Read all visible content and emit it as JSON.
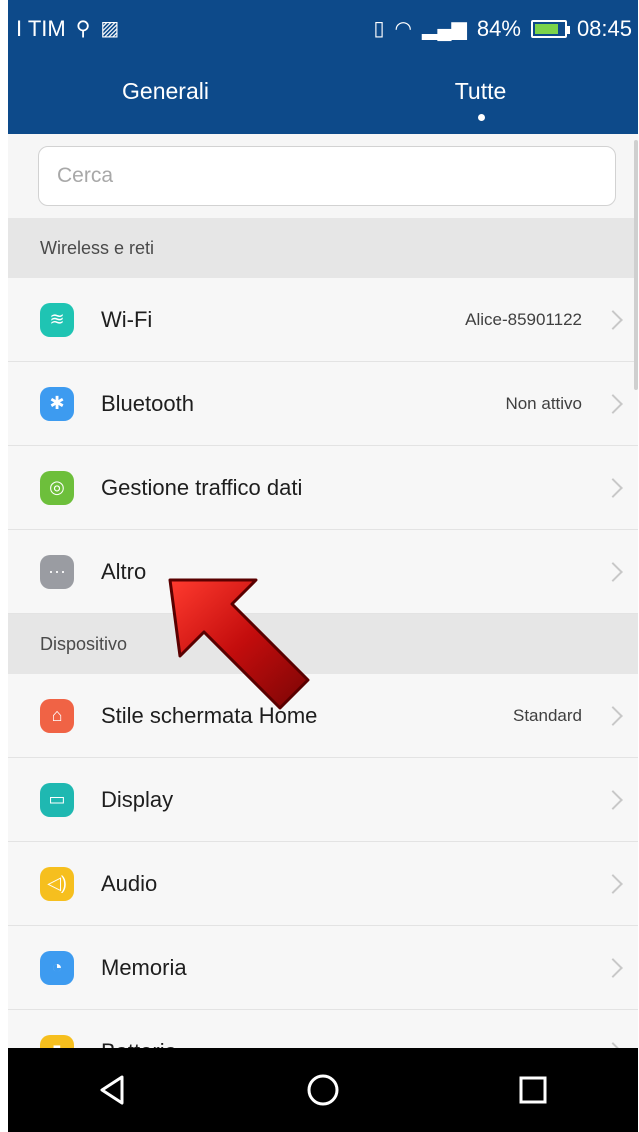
{
  "status_bar": {
    "carrier": "I TIM",
    "battery_text": "84%",
    "battery_fill_percent": 84,
    "time": "08:45"
  },
  "header": {
    "tabs": [
      {
        "label": "Generali",
        "active": false
      },
      {
        "label": "Tutte",
        "active": true
      }
    ]
  },
  "search": {
    "placeholder": "Cerca"
  },
  "sections": {
    "wireless_title": "Wireless e reti",
    "device_title": "Dispositivo"
  },
  "items": {
    "wifi": {
      "label": "Wi-Fi",
      "value": "Alice-85901122",
      "icon": "wifi-icon",
      "color": "#1fc4b3"
    },
    "bluetooth": {
      "label": "Bluetooth",
      "value": "Non attivo",
      "icon": "bluetooth-icon",
      "color": "#3d9bf0"
    },
    "data": {
      "label": "Gestione traffico dati",
      "value": "",
      "icon": "data-traffic-icon",
      "color": "#6dbf3b"
    },
    "altro": {
      "label": "Altro",
      "value": "",
      "icon": "more-icon",
      "color": "#9a9ca2"
    },
    "home": {
      "label": "Stile schermata Home",
      "value": "Standard",
      "icon": "home-icon",
      "color": "#f06345"
    },
    "display": {
      "label": "Display",
      "value": "",
      "icon": "display-icon",
      "color": "#1fb8b1"
    },
    "audio": {
      "label": "Audio",
      "value": "",
      "icon": "audio-icon",
      "color": "#f6bf1e"
    },
    "memoria": {
      "label": "Memoria",
      "value": "",
      "icon": "memory-icon",
      "color": "#3d9bf0"
    },
    "batteria": {
      "label": "Batteria",
      "value": "",
      "icon": "battery-icon",
      "color": "#f6bf1e"
    }
  },
  "navbar": {
    "buttons": [
      "back-icon",
      "home-circle-icon",
      "recents-icon"
    ]
  }
}
